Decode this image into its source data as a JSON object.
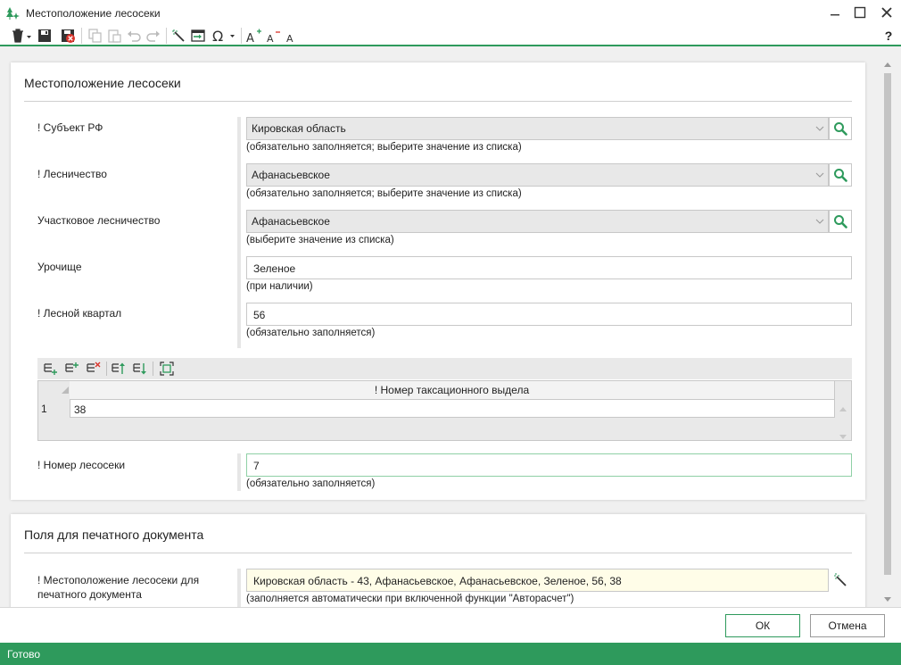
{
  "window": {
    "title": "Местоположение лесосеки",
    "help_label": "?"
  },
  "toolbar": {
    "icons": [
      "delete-icon",
      "save-icon",
      "save-close-icon",
      "copy-icon",
      "paste-icon",
      "undo-icon",
      "redo-icon",
      "magic-wand-icon",
      "import-icon",
      "omega-symbol-icon",
      "font-increase-icon",
      "font-decrease-icon",
      "font-reset-icon"
    ]
  },
  "section1": {
    "title": "Местоположение лесосеки",
    "fields": [
      {
        "label": "! Субъект РФ",
        "value": "Кировская область",
        "hint": "(обязательно заполняется; выберите значение из списка)"
      },
      {
        "label": "! Лесничество",
        "value": "Афанасьевское",
        "hint": "(обязательно заполняется; выберите значение из списка)"
      },
      {
        "label": "Участковое лесничество",
        "value": "Афанасьевское",
        "hint": "(выберите значение из списка)"
      },
      {
        "label": "Урочище",
        "value": "Зеленое",
        "hint": "(при наличии)"
      },
      {
        "label": "! Лесной квартал",
        "value": "56",
        "hint": "(обязательно заполняется)"
      }
    ],
    "grid": {
      "column": "! Номер таксационного выдела",
      "rows": [
        {
          "num": "1",
          "value": "38"
        }
      ]
    },
    "plot_number": {
      "label": "! Номер лесосеки",
      "value": "7",
      "hint": "(обязательно заполняется)"
    }
  },
  "section2": {
    "title": "Поля для печатного документа",
    "location": {
      "label_line1": "! Местоположение лесосеки для",
      "label_line2": "печатного документа",
      "value": "Кировская область - 43, Афанасьевское, Афанасьевское, Зеленое, 56, 38",
      "hint": "(заполняется автоматически при включенной функции \"Авторасчет\")"
    }
  },
  "buttons": {
    "ok": "ОК",
    "cancel": "Отмена"
  },
  "status": "Готово",
  "colors": {
    "accent": "#2e9a5c",
    "highlight": "#fffde8"
  }
}
